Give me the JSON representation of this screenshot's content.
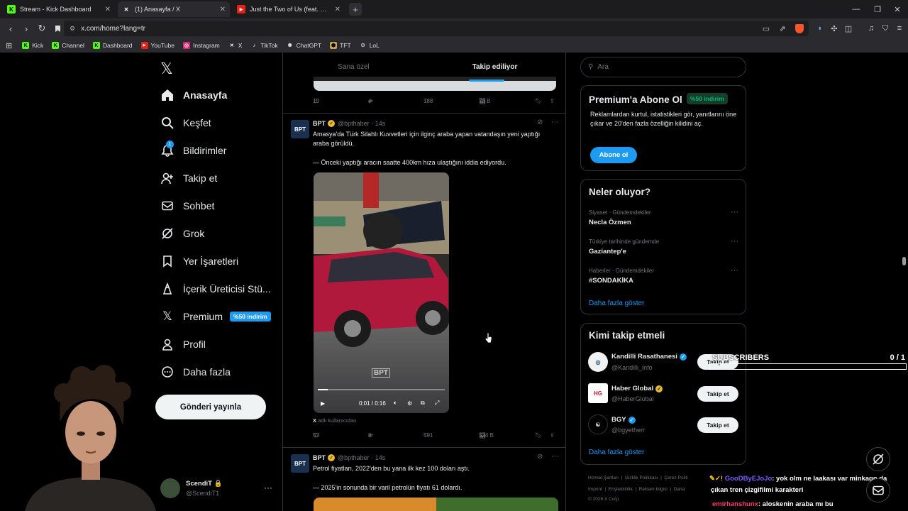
{
  "browser": {
    "tabs": [
      {
        "title": "Stream - Kick Dashboard",
        "icon": "kick-icon",
        "close": "✕"
      },
      {
        "title": "(1) Anasayfa / X",
        "icon": "x-logo-icon",
        "close": "✕"
      },
      {
        "title": "Just the Two of Us (feat. Bill Withers)",
        "icon": "youtube-icon",
        "close": "✕"
      }
    ],
    "new_tab": "+",
    "url": "x.com/home?lang=tr",
    "bookmarks": [
      "Kick",
      "Channel",
      "Dashboard",
      "YouTube",
      "Instagram",
      "X",
      "TikTok",
      "ChatGPT",
      "TFT",
      "LoL"
    ]
  },
  "nav": {
    "items": [
      {
        "label": "Anasayfa",
        "icon": "home-icon",
        "active": true
      },
      {
        "label": "Keşfet",
        "icon": "search-icon"
      },
      {
        "label": "Bildirimler",
        "icon": "bell-icon",
        "count": "1"
      },
      {
        "label": "Takip et",
        "icon": "follow-icon"
      },
      {
        "label": "Sohbet",
        "icon": "mail-icon"
      },
      {
        "label": "Grok",
        "icon": "grok-icon"
      },
      {
        "label": "Yer İşaretleri",
        "icon": "bookmark-icon"
      },
      {
        "label": "İçerik Üreticisi Stü...",
        "icon": "creator-studio-icon"
      },
      {
        "label": "Premium",
        "icon": "x-logo-icon",
        "badge": "%50 indirim"
      },
      {
        "label": "Profil",
        "icon": "profile-icon"
      },
      {
        "label": "Daha fazla",
        "icon": "more-circle-icon"
      }
    ],
    "post_button": "Gönderi yayınla",
    "profile": {
      "name": "ScendiT",
      "handle": "@ScendiT1",
      "more": "···"
    }
  },
  "feed": {
    "tabs": [
      "Sana özel",
      "Takip ediliyor"
    ],
    "top_actions": {
      "replies": "10",
      "reposts": "4",
      "likes": "188",
      "views": "76 B"
    },
    "posts": [
      {
        "avatar": "BPT",
        "name": "BPT",
        "handle": "@bpthaber",
        "time": "· 14s",
        "text1": "Amasya'da Türk Silahlı Kuvvetleri için ilginç araba yapan vatandaşın yeni yaptığı araba görüldü.",
        "text2": "— Önceki yaptığı aracın saatte 400km hıza ulaştığını iddia ediyordu.",
        "video_time": "0:01 / 0:16",
        "watermark": "BPT",
        "source": "adlı kullanıcıdan",
        "source_logo": "X",
        "replies": "52",
        "reposts": "8",
        "likes": "591",
        "views": "324 B"
      },
      {
        "avatar": "BPT",
        "name": "BPT",
        "handle": "@bpthaber",
        "time": "· 14s",
        "text1": "Petrol fiyatları, 2022'den bu yana ilk kez 100 doları aştı.",
        "text2": "— 2025'in sonunda bir varil petrolün fiyatı 61 dolardı."
      }
    ]
  },
  "sidebar": {
    "search_placeholder": "Ara",
    "premium": {
      "title": "Premium'a Abone Ol",
      "badge": "%50 indirim",
      "text": "Reklamlardan kurtul, istatistikleri gör, yanıtlarını öne çıkar ve 20'den fazla özelliğin kilidini aç.",
      "button": "Abone ol"
    },
    "trends": {
      "title": "Neler oluyor?",
      "items": [
        {
          "category": "Siyaset · Gündemdekiler",
          "name": "Necla Özmen"
        },
        {
          "category": "Türkiye tarihinde gündemde",
          "name": "Gaziantep'e"
        },
        {
          "category": "Haberler · Gündemdekiler",
          "name": "#SONDAKİKA"
        }
      ],
      "more": "Daha fazla göster"
    },
    "who": {
      "title": "Kimi takip etmeli",
      "items": [
        {
          "name": "Kandilli Rasathanesi",
          "handle": "@Kandilli_info",
          "button": "Takip et",
          "verify_color": "#1d9bf0"
        },
        {
          "name": "Haber Global",
          "handle": "@HaberGlobal",
          "button": "Takip et",
          "verify_color": "#e8b931"
        },
        {
          "name": "BGY",
          "handle": "@bgyetherr",
          "button": "Takip et",
          "verify_color": "#1d9bf0"
        }
      ],
      "more": "Daha fazla göster"
    },
    "footer": {
      "line1": [
        "Hizmet Şartları",
        "Gizlilik Politikası",
        "Çerez Politi"
      ],
      "line2": [
        "Imprint",
        "Erişilebilirlik",
        "Reklam bilgisi",
        "Daha"
      ],
      "copyright": "© 2026 X Corp."
    }
  },
  "overlay": {
    "subscribers_label": "SUBSCRIBERS",
    "subscribers_count": "0 / 1",
    "chat": [
      {
        "user": "GooDByEJoJo",
        "text": ": yok olm ne laakası var minkago da",
        "text2": "çıkan tren çizgifilmi karakteri",
        "color": "#7b5cff"
      },
      {
        "user": "emirhanshunx",
        "text": ": aloskenin araba mı bu",
        "color": "#ff3b6b"
      }
    ]
  }
}
